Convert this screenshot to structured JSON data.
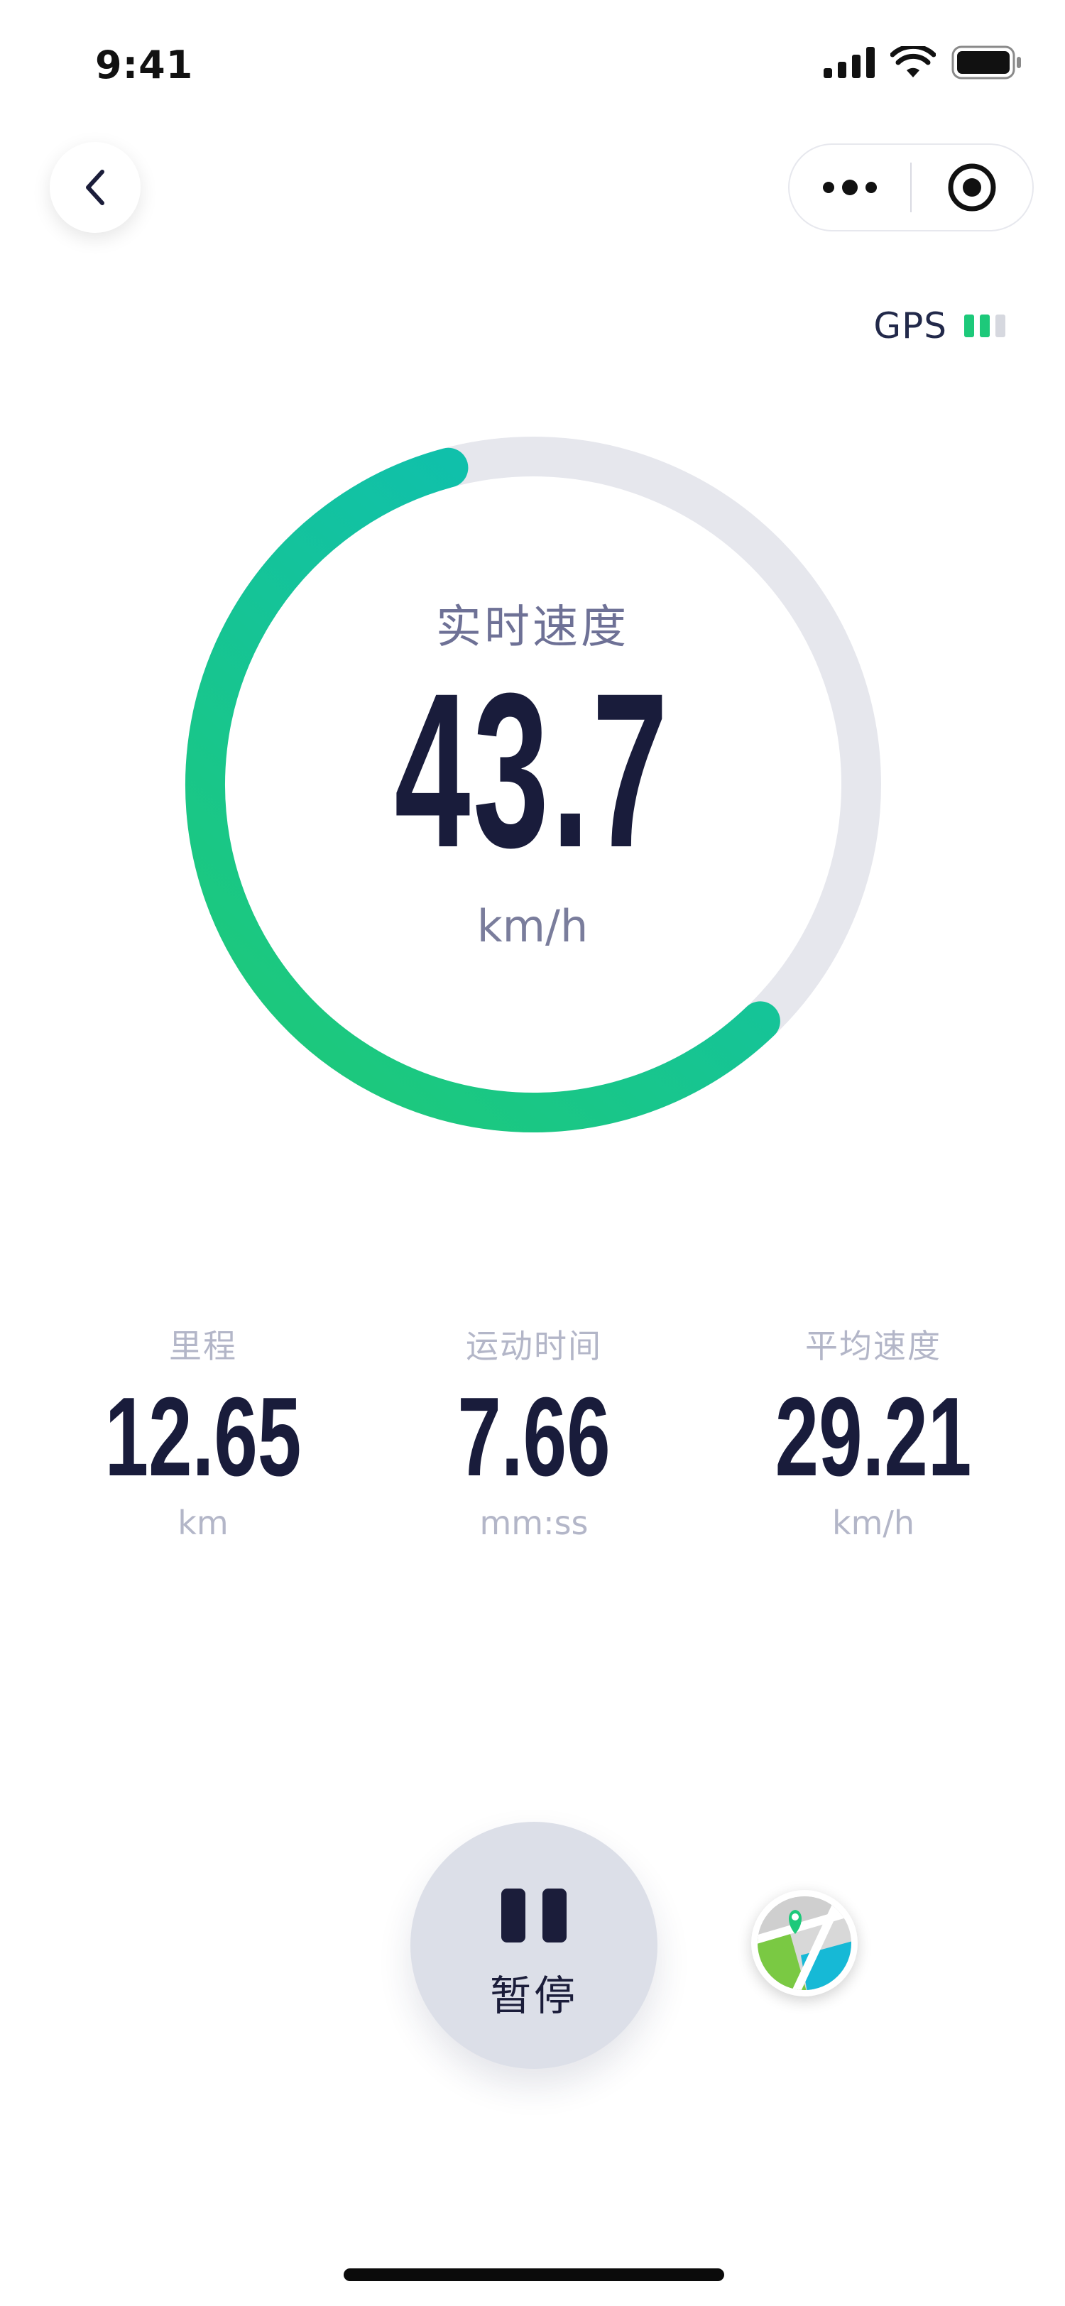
{
  "status_bar": {
    "time": "9:41"
  },
  "top": {
    "back_icon": "chevron-left-icon",
    "more_icon": "more-dots-icon",
    "close_icon": "target-circle-icon"
  },
  "gps": {
    "label": "GPS",
    "signal_bars_active": 2,
    "signal_bars_total": 3,
    "active_color": "#1dc97a",
    "inactive_color": "#d6d8df"
  },
  "gauge": {
    "label": "实时速度",
    "value": "43.7",
    "unit": "km/h",
    "progress_fraction": 0.58,
    "gradient_start": "#1dc97a",
    "gradient_end": "#0bbdbd",
    "track_color": "#e6e7ed"
  },
  "stats": [
    {
      "label": "里程",
      "value": "12.65",
      "unit": "km"
    },
    {
      "label": "运动时间",
      "value": "7.66",
      "unit": "mm:ss"
    },
    {
      "label": "平均速度",
      "value": "29.21",
      "unit": "km/h"
    }
  ],
  "controls": {
    "pause_label": "暂停",
    "pause_icon": "pause-icon",
    "map_icon": "map-icon"
  }
}
